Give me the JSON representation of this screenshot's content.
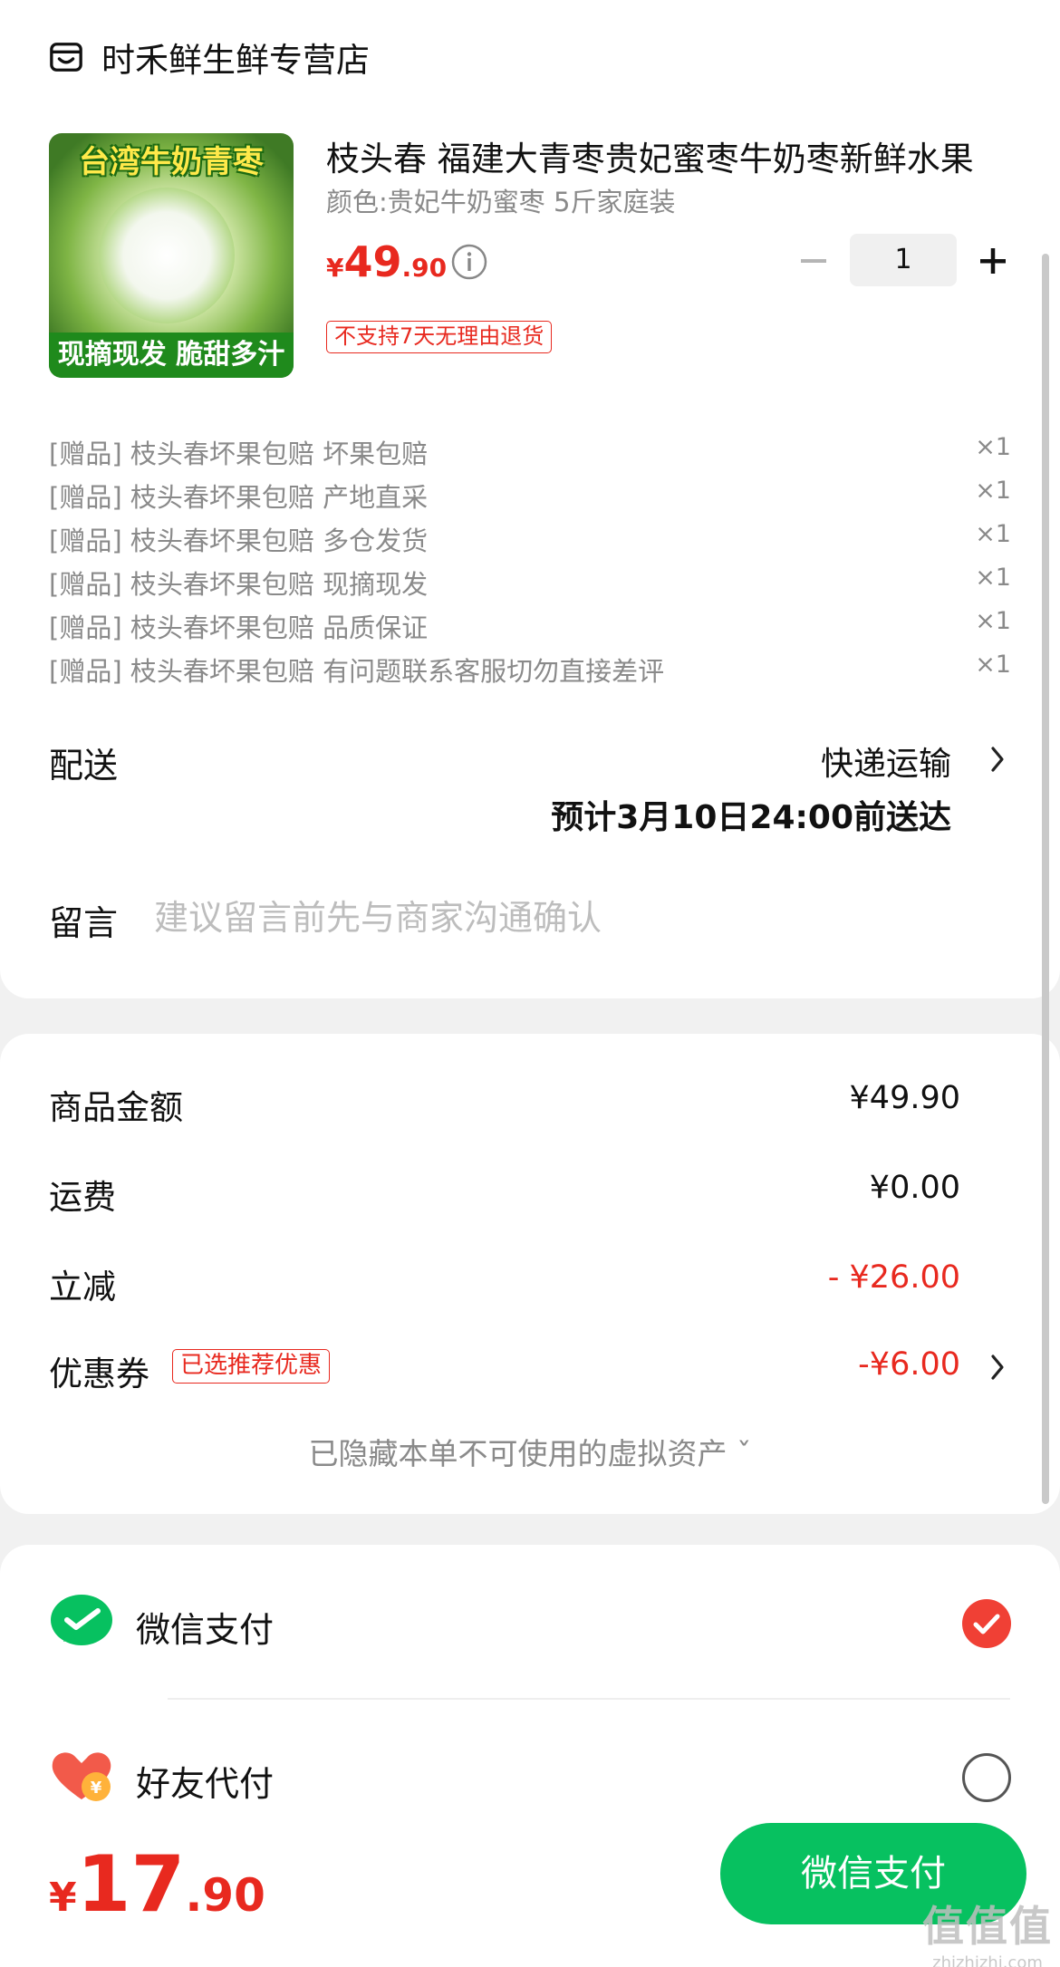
{
  "store": {
    "name": "时禾鲜生鲜专营店",
    "icon": "store-icon"
  },
  "product": {
    "image_top_text": "台湾牛奶青枣",
    "image_bottom_text": "现摘现发 脆甜多汁",
    "title": "枝头春 福建大青枣贵妃蜜枣牛奶枣新鲜水果",
    "spec": "颜色:贵妃牛奶蜜枣 5斤家庭装",
    "price_currency": "¥",
    "price_int": "49",
    "price_dec": ".90",
    "quantity": "1",
    "no_refund_tag": "不支持7天无理由退货"
  },
  "gifts": [
    {
      "name": "[赠品] 枝头春坏果包赔 坏果包赔",
      "qty": "×1"
    },
    {
      "name": "[赠品] 枝头春坏果包赔 产地直采",
      "qty": "×1"
    },
    {
      "name": "[赠品] 枝头春坏果包赔 多仓发货",
      "qty": "×1"
    },
    {
      "name": "[赠品] 枝头春坏果包赔 现摘现发",
      "qty": "×1"
    },
    {
      "name": "[赠品] 枝头春坏果包赔 品质保证",
      "qty": "×1"
    },
    {
      "name": "[赠品] 枝头春坏果包赔 有问题联系客服切勿直接差评",
      "qty": "×1"
    }
  ],
  "delivery": {
    "label": "配送",
    "method": "快递运输",
    "estimate": "预计3月10日24:00前送达"
  },
  "message": {
    "label": "留言",
    "placeholder": "建议留言前先与商家沟通确认"
  },
  "amounts": {
    "goods_label": "商品金额",
    "goods_value": "¥49.90",
    "shipping_label": "运费",
    "shipping_value": "¥0.00",
    "discount_label": "立减",
    "discount_value": "- ¥26.00",
    "coupon_label": "优惠券",
    "coupon_tag": "已选推荐优惠",
    "coupon_value": "-¥6.00",
    "hidden_assets": "已隐藏本单不可使用的虚拟资产 ˇ"
  },
  "payment": {
    "wechat_label": "微信支付",
    "friend_label": "好友代付",
    "selected": "wechat"
  },
  "bottom": {
    "total_currency": "¥",
    "total_int": "17",
    "total_dec": ".90",
    "pay_button": "微信支付"
  },
  "watermark": {
    "line1": "值值值",
    "line2": "zhizhizhi.com"
  },
  "colors": {
    "accent_red": "#e8291f",
    "wechat_green": "#07c160",
    "muted": "#8a8a8a"
  }
}
